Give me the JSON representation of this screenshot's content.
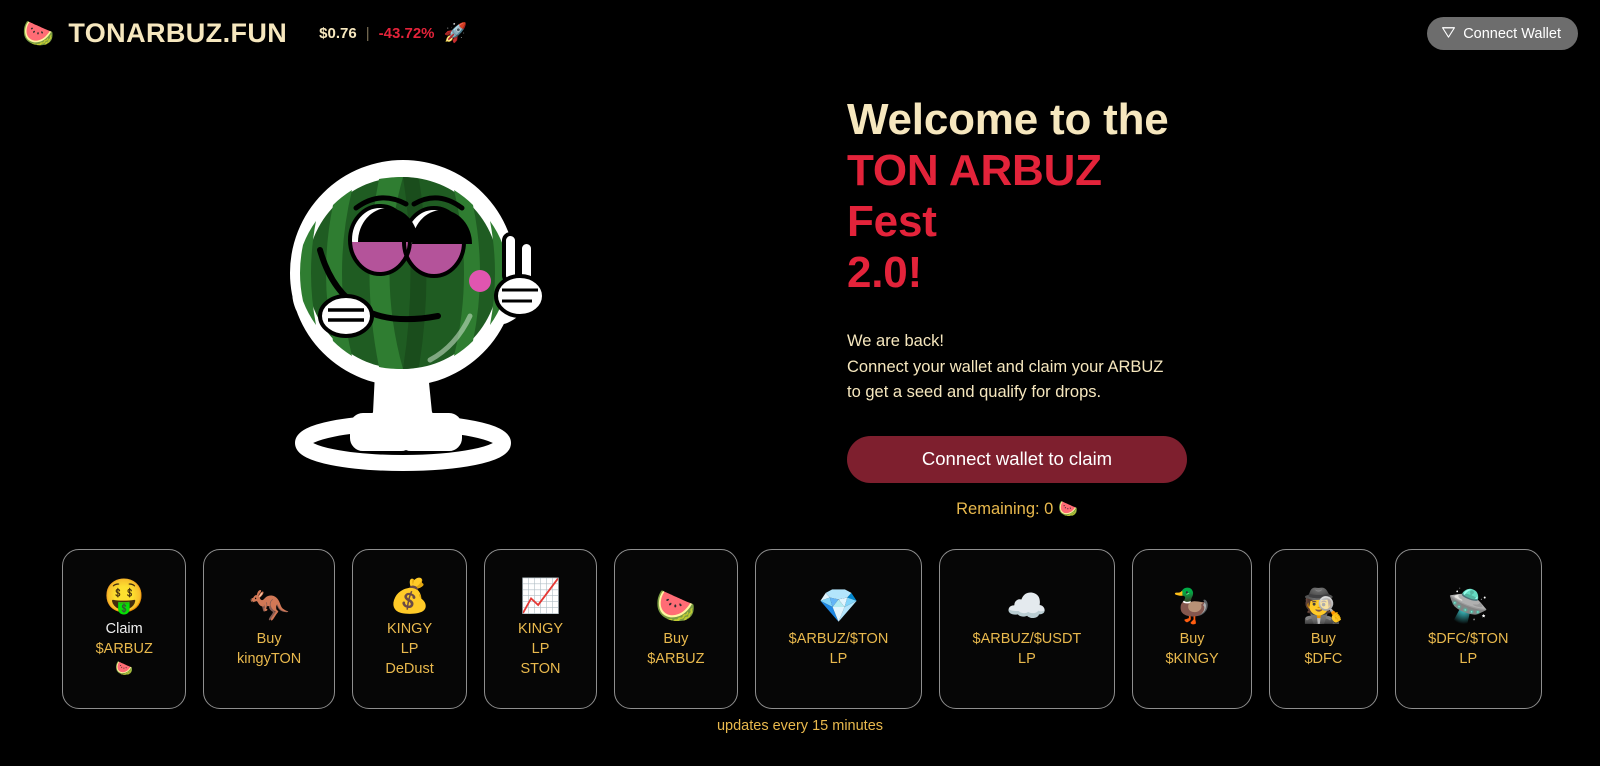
{
  "header": {
    "logo_icon": "watermelon-icon",
    "logo_emoji": "🍉",
    "brand": "TONARBUZ.FUN",
    "price": "$0.76",
    "separator": "|",
    "change": "-43.72%",
    "rocket_emoji": "🚀",
    "connect_wallet_label": "Connect Wallet",
    "wallet_icon": "ton-diamond-icon"
  },
  "hero": {
    "heading_line1": "Welcome to the",
    "heading_line2": "TON ARBUZ Fest",
    "heading_line3": "2.0!",
    "sub_line1": "We are back!",
    "sub_line2": "Connect your wallet and claim your ARBUZ",
    "sub_line3": "to get a seed and qualify for drops.",
    "claim_button": "Connect wallet to claim",
    "remaining_label": "Remaining: 0",
    "remaining_emoji": "🍉",
    "mascot": "watermelon-mascot"
  },
  "cards": [
    {
      "icon": "money-duck-icon",
      "emoji": "🤑",
      "label_main": "Claim",
      "label_gold": "$ARBUZ",
      "label_emoji": "🍉",
      "label": "Claim\n$ARBUZ\n🍉"
    },
    {
      "icon": "kangaroo-icon",
      "emoji": "🦘",
      "label": "Buy\nkingyTON"
    },
    {
      "icon": "money-bag-icon",
      "emoji": "💰",
      "label": "KINGY\nLP\nDeDust"
    },
    {
      "icon": "chart-increasing-icon",
      "emoji": "📈",
      "label": "KINGY\nLP\nSTON"
    },
    {
      "icon": "watermelon-slice-icon",
      "emoji": "🍉",
      "label": "Buy\n$ARBUZ"
    },
    {
      "icon": "gem-icon",
      "emoji": "💎",
      "label": "$ARBUZ/$TON\nLP"
    },
    {
      "icon": "cloud-creature-icon",
      "emoji": "☁️",
      "label": "$ARBUZ/$USDT\nLP"
    },
    {
      "icon": "cool-duck-icon",
      "emoji": "🦆",
      "label": "Buy\n$KINGY"
    },
    {
      "icon": "detective-icon",
      "emoji": "🕵️",
      "label": "Buy\n$DFC"
    },
    {
      "icon": "rocket-space-icon",
      "emoji": "🛸",
      "label": "$DFC/$TON\nLP"
    }
  ],
  "footer": {
    "note": "updates every 15 minutes"
  },
  "colors": {
    "background": "#000000",
    "cream": "#F6E7BE",
    "red": "#E3233A",
    "gold": "#E9B94D",
    "button_maroon": "#7E1F2E",
    "wallet_gray": "#6D6D6D",
    "card_border": "#8E8E8E"
  }
}
